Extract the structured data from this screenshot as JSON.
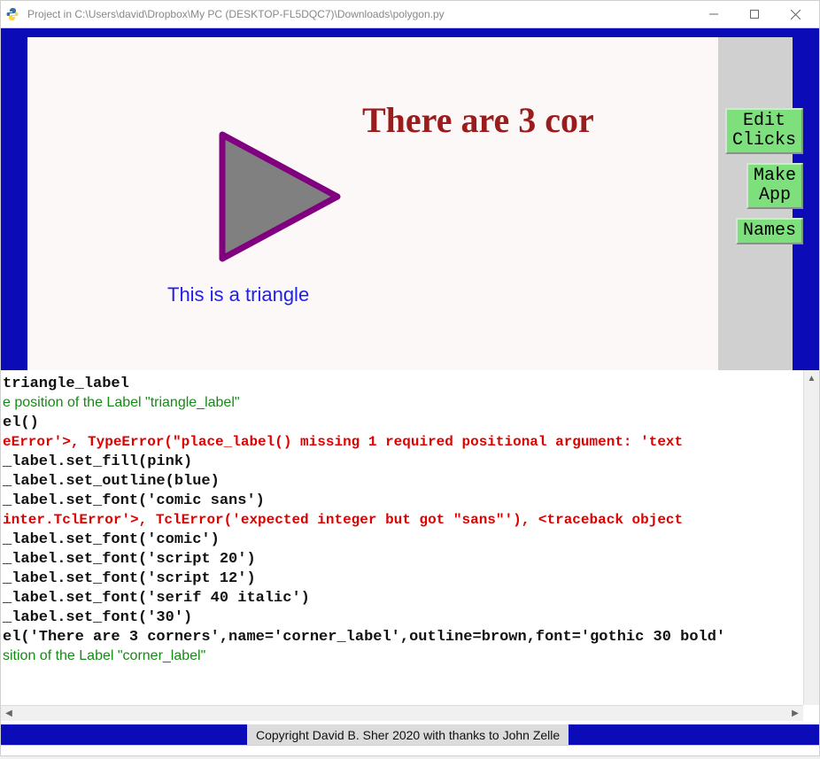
{
  "window": {
    "title": "Project in C:\\Users\\david\\Dropbox\\My PC (DESKTOP-FL5DQC7)\\Downloads\\polygon.py"
  },
  "canvas": {
    "corner_label": "There are 3 cor",
    "triangle_label": "This is a triangle"
  },
  "buttons": {
    "edit_clicks": "Edit\nClicks",
    "make_app": "Make\nApp",
    "names": "Names"
  },
  "console": {
    "lines": [
      {
        "cls": "c-black mono",
        "text": " triangle_label"
      },
      {
        "cls": "c-green",
        "text": "e position of the Label \"triangle_label\""
      },
      {
        "cls": "c-black mono",
        "text": "el()"
      },
      {
        "cls": "c-red",
        "text": "eError'>, TypeError(\"place_label() missing 1 required positional argument: 'text"
      },
      {
        "cls": "c-black mono",
        "text": "_label.set_fill(pink)"
      },
      {
        "cls": "c-black mono",
        "text": "_label.set_outline(blue)"
      },
      {
        "cls": "c-black mono",
        "text": "_label.set_font('comic sans')"
      },
      {
        "cls": "c-red",
        "text": "inter.TclError'>, TclError('expected integer but got \"sans\"'), <traceback object"
      },
      {
        "cls": "c-black mono",
        "text": "_label.set_font('comic')"
      },
      {
        "cls": "c-black mono",
        "text": "_label.set_font('script 20')"
      },
      {
        "cls": "c-black mono",
        "text": "_label.set_font('script 12')"
      },
      {
        "cls": "c-black mono",
        "text": "_label.set_font('serif 40 italic')"
      },
      {
        "cls": "c-black mono",
        "text": "_label.set_font('30')"
      },
      {
        "cls": "c-black mono",
        "text": "el('There are 3 corners',name='corner_label',outline=brown,font='gothic 30 bold'"
      },
      {
        "cls": "c-green",
        "text": "sition of the Label \"corner_label\""
      }
    ]
  },
  "footer": {
    "copyright": "Copyright David B. Sher 2020 with thanks to John Zelle"
  }
}
